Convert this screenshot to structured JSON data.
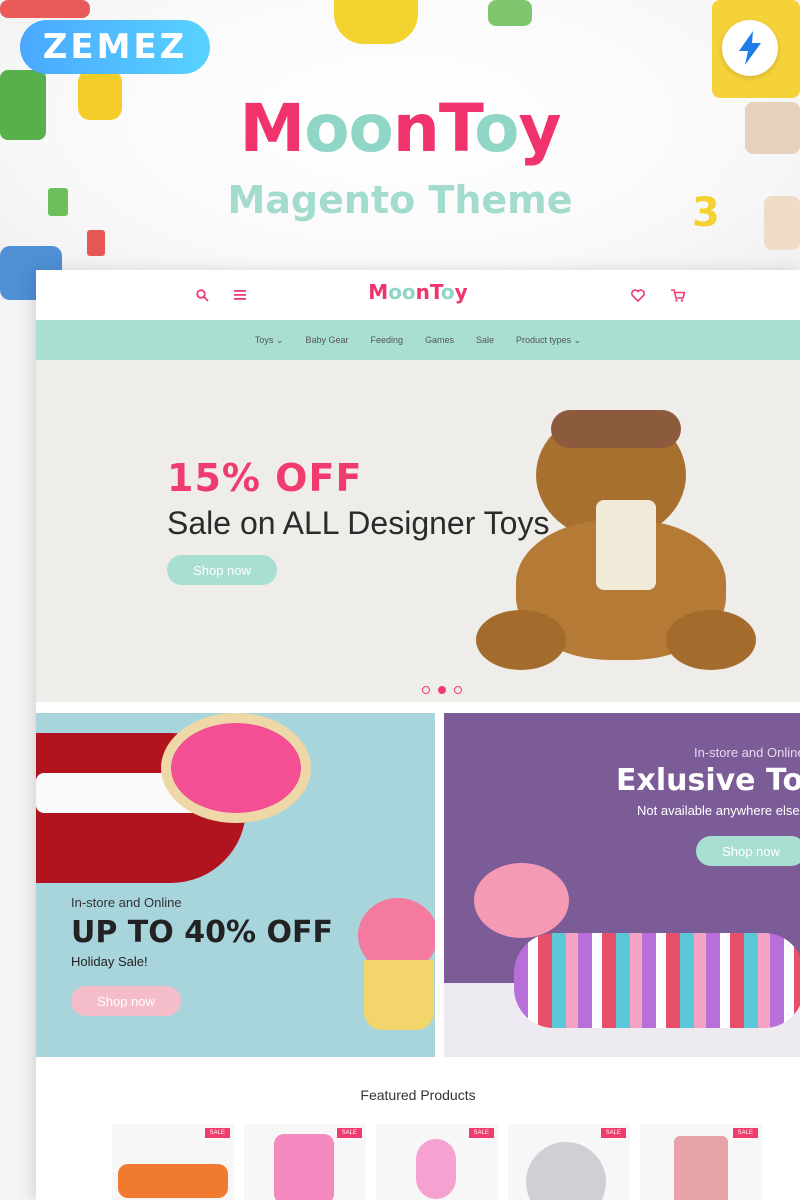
{
  "promo": {
    "zemez": "ZEMEZ",
    "logo_parts": [
      "M",
      "oo",
      "nT",
      "o",
      "y"
    ],
    "subtitle": "Magento Theme",
    "number": "3"
  },
  "store": {
    "logo_parts": [
      "M",
      "oo",
      "nT",
      "o",
      "y"
    ],
    "nav": [
      "Toys",
      "Baby Gear",
      "Feeding",
      "Games",
      "Sale",
      "Product types"
    ],
    "slider": {
      "discount": "15% OFF",
      "title": "Sale on ALL Designer Toys",
      "button": "Shop now"
    },
    "banner_left": {
      "small": "In-store and Online",
      "big": "UP TO 40% OFF",
      "sub": "Holiday Sale!",
      "button": "Shop now"
    },
    "banner_right": {
      "small": "In-store and Online",
      "big": "Exlusive Toys",
      "sub": "Not available anywhere else",
      "button": "Shop now"
    },
    "featured_title": "Featured Products",
    "sale_badge": "SALE",
    "colors": {
      "brand": "#ef3b6e",
      "mint": "#a8dfd2"
    }
  }
}
